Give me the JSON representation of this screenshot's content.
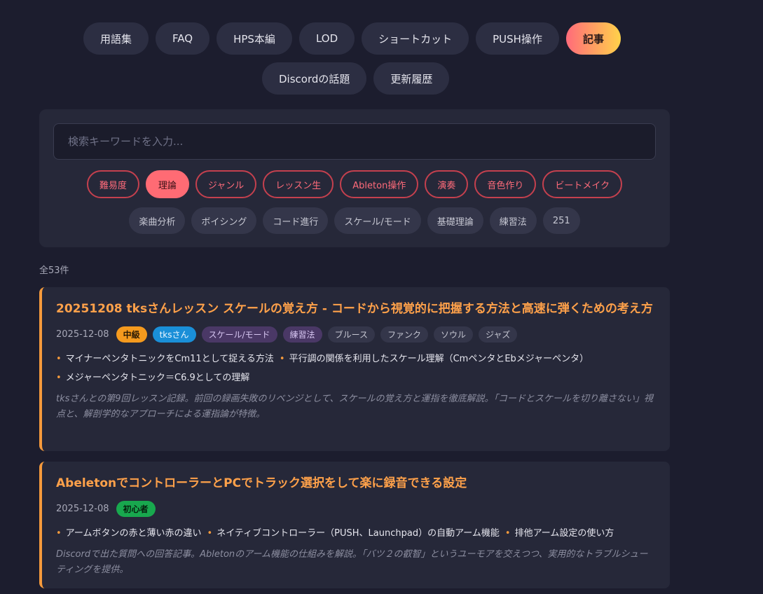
{
  "nav": {
    "row1": [
      "用語集",
      "FAQ",
      "HPS本編",
      "LOD",
      "ショートカット",
      "PUSH操作",
      "記事"
    ],
    "row2": [
      "Discordの話題",
      "更新履歴"
    ],
    "active": "記事"
  },
  "search": {
    "placeholder": "検索キーワードを入力...",
    "value": ""
  },
  "categories": [
    "難易度",
    "理論",
    "ジャンル",
    "レッスン生",
    "Ableton操作",
    "演奏",
    "音色作り",
    "ビートメイク"
  ],
  "active_category": "理論",
  "subcategories": [
    "楽曲分析",
    "ボイシング",
    "コード進行",
    "スケール/モード",
    "基礎理論",
    "練習法",
    "251"
  ],
  "result_count": "全53件",
  "articles": [
    {
      "title": "20251208 tksさんレッスン スケールの覚え方 - コードから視覚的に把握する方法と高速に弾くための考え方",
      "date": "2025-12-08",
      "tags": [
        "中級",
        "tksさん",
        "スケール/モード",
        "練習法",
        "ブルース",
        "ファンク",
        "ソウル",
        "ジャズ"
      ],
      "points": [
        "マイナーペンタトニックをCm11として捉える方法",
        "平行調の関係を利用したスケール理解（CmペンタとEbメジャーペンタ）",
        "メジャーペンタトニック＝C6.9としての理解"
      ],
      "summary": "tksさんとの第9回レッスン記録。前回の録画失敗のリベンジとして、スケールの覚え方と運指を徹底解説。「コードとスケールを切り離さない」視点と、解剖学的なアプローチによる運指論が特徴。"
    },
    {
      "title": "AbeletonでコントローラーとPCでトラック選択をして楽に録音できる設定",
      "date": "2025-12-08",
      "tags": [
        "初心者"
      ],
      "points": [
        "アームボタンの赤と薄い赤の違い",
        "ネイティブコントローラー（PUSH、Launchpad）の自動アーム機能",
        "排他アーム設定の使い方"
      ],
      "summary": "Discordで出た質問への回答記事。Abletonのアーム機能の仕組みを解説。「バツ２の叡智」というユーモアを交えつつ、実用的なトラブルシューティングを提供。"
    }
  ],
  "colors": {
    "background": "#1c1d2e",
    "panel": "#262839",
    "accent_orange": "#ffa14a",
    "accent_red": "#ff6b7a",
    "active_gradient": [
      "#ff6b7a",
      "#ffd24a"
    ]
  }
}
